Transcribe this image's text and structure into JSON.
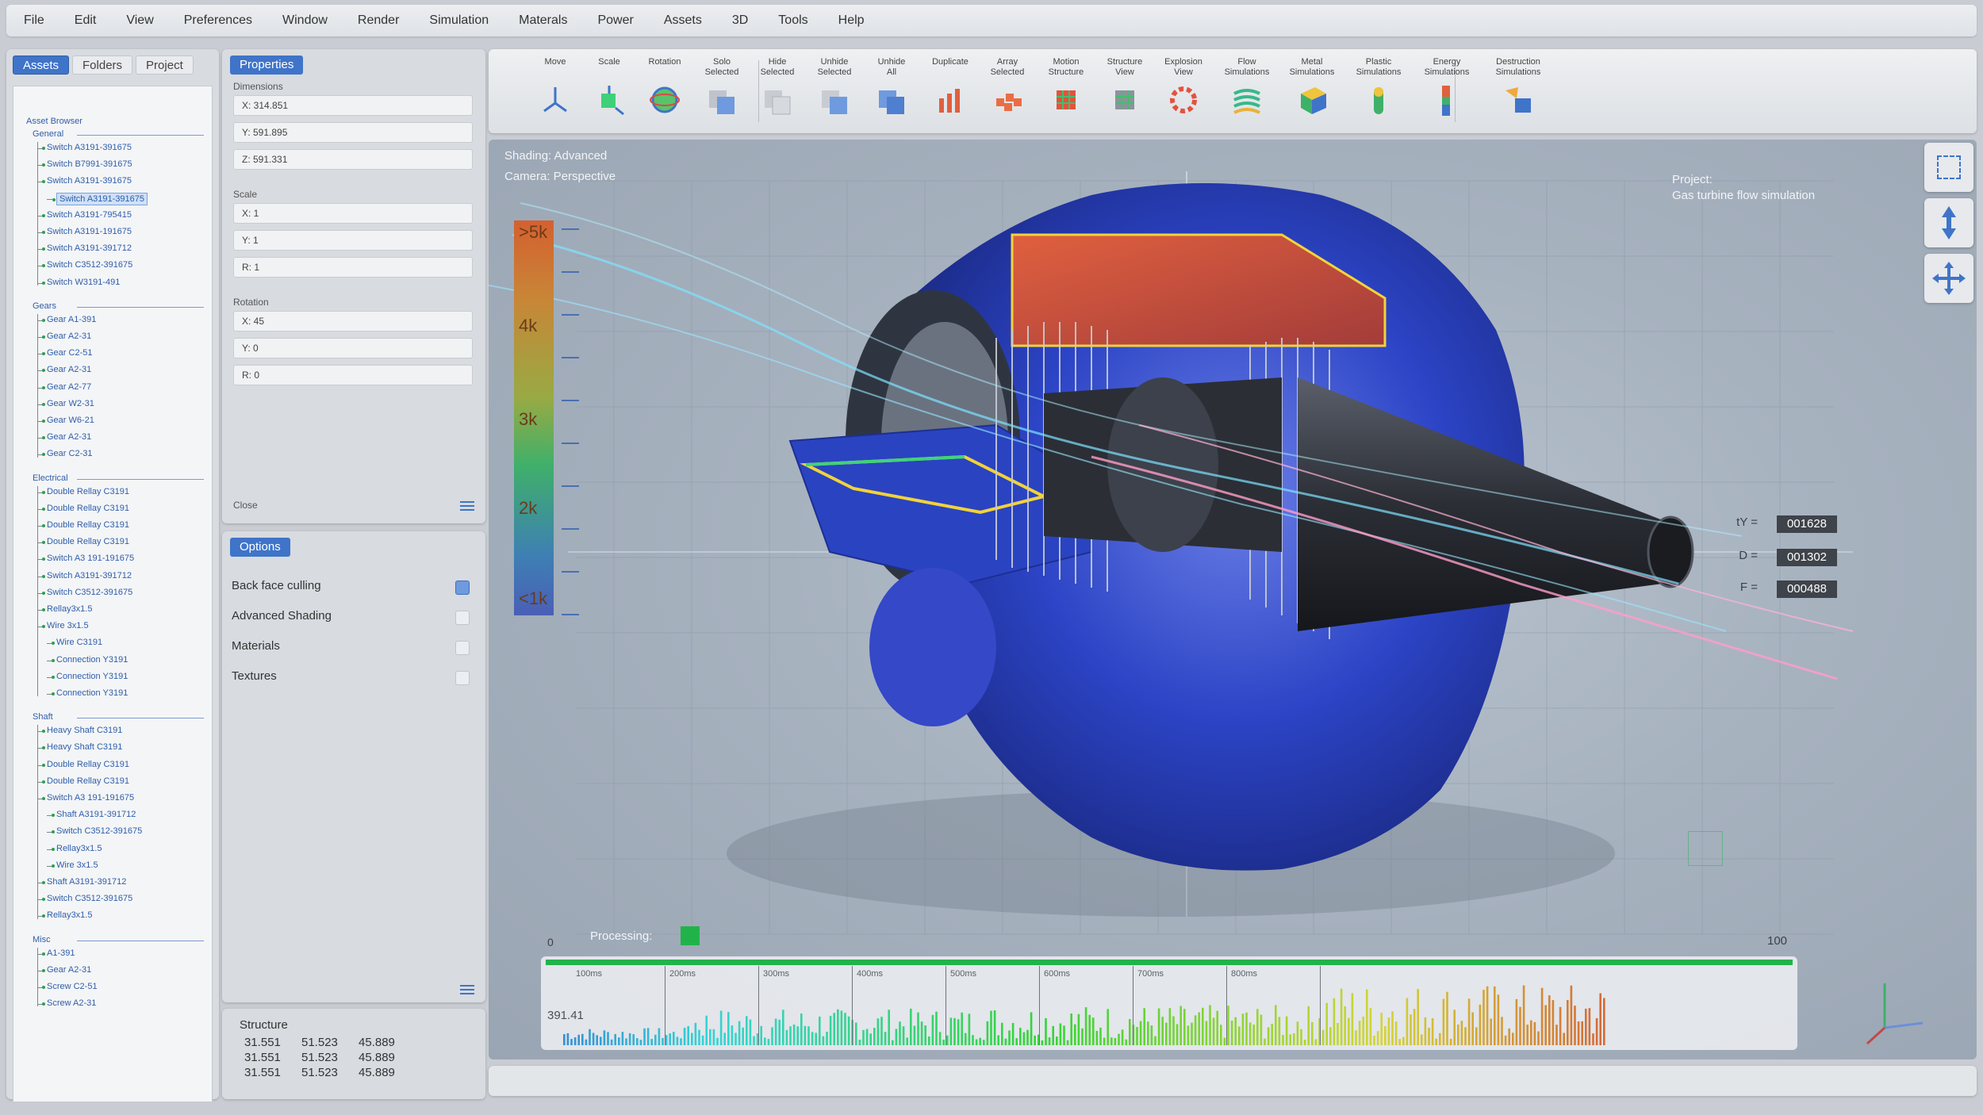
{
  "menu": [
    "File",
    "Edit",
    "View",
    "Preferences",
    "Window",
    "Render",
    "Simulation",
    "Materals",
    "Power",
    "Assets",
    "3D",
    "Tools",
    "Help"
  ],
  "assets_panel": {
    "tabs": [
      "Assets",
      "Folders",
      "Project"
    ],
    "active_tab": "Assets",
    "browser_title": "Asset Browser",
    "groups": [
      {
        "label": "General",
        "items": [
          {
            "label": "Switch A3191-391675",
            "level": 1
          },
          {
            "label": "Switch B7991-391675",
            "level": 1
          },
          {
            "label": "Switch A3191-391675",
            "level": 1
          },
          {
            "label": "Switch A3191-391675",
            "level": 2,
            "selected": true
          },
          {
            "label": "Switch A3191-795415",
            "level": 1
          },
          {
            "label": "Switch A3191-191675",
            "level": 1
          },
          {
            "label": "Switch A3191-391712",
            "level": 1
          },
          {
            "label": "Switch C3512-391675",
            "level": 1
          },
          {
            "label": "Switch W3191-491",
            "level": 1
          }
        ]
      },
      {
        "label": "Gears",
        "items": [
          {
            "label": "Gear A1-391",
            "level": 1
          },
          {
            "label": "Gear A2-31",
            "level": 1
          },
          {
            "label": "Gear C2-51",
            "level": 1
          },
          {
            "label": "Gear A2-31",
            "level": 1
          },
          {
            "label": "Gear A2-77",
            "level": 1
          },
          {
            "label": "Gear W2-31",
            "level": 1
          },
          {
            "label": "Gear W6-21",
            "level": 1
          },
          {
            "label": "Gear A2-31",
            "level": 1
          },
          {
            "label": "Gear C2-31",
            "level": 1
          }
        ]
      },
      {
        "label": "Electrical",
        "items": [
          {
            "label": "Double Rellay C3191",
            "level": 1
          },
          {
            "label": "Double Rellay C3191",
            "level": 1
          },
          {
            "label": "Double Rellay C3191",
            "level": 1
          },
          {
            "label": "Double Rellay C3191",
            "level": 1
          },
          {
            "label": "Switch A3 191-191675",
            "level": 1
          },
          {
            "label": "Switch A3191-391712",
            "level": 1
          },
          {
            "label": "Switch C3512-391675",
            "level": 1
          },
          {
            "label": "Rellay3x1.5",
            "level": 1
          },
          {
            "label": "Wire 3x1.5",
            "level": 1
          },
          {
            "label": "Wire C3191",
            "level": 2
          },
          {
            "label": "Connection Y3191",
            "level": 2
          },
          {
            "label": "Connection Y3191",
            "level": 2
          },
          {
            "label": "Connection Y3191",
            "level": 2
          }
        ]
      },
      {
        "label": "Shaft",
        "items": [
          {
            "label": "Heavy Shaft C3191",
            "level": 1
          },
          {
            "label": "Heavy Shaft C3191",
            "level": 1
          },
          {
            "label": "Double Rellay C3191",
            "level": 1
          },
          {
            "label": "Double Rellay C3191",
            "level": 1
          },
          {
            "label": "Switch A3 191-191675",
            "level": 1
          },
          {
            "label": "Shaft A3191-391712",
            "level": 2
          },
          {
            "label": "Switch C3512-391675",
            "level": 2
          },
          {
            "label": "Rellay3x1.5",
            "level": 2
          },
          {
            "label": "Wire 3x1.5",
            "level": 2
          },
          {
            "label": "Shaft A3191-391712",
            "level": 1
          },
          {
            "label": "Switch C3512-391675",
            "level": 1
          },
          {
            "label": "Rellay3x1.5",
            "level": 1
          }
        ]
      },
      {
        "label": "Misc",
        "items": [
          {
            "label": "A1-391",
            "level": 1
          },
          {
            "label": "Gear A2-31",
            "level": 1
          },
          {
            "label": "Screw C2-51",
            "level": 1
          },
          {
            "label": "Screw A2-31",
            "level": 1
          }
        ]
      }
    ]
  },
  "properties": {
    "title": "Properties",
    "dimensions_label": "Dimensions",
    "dimensions": [
      "X: 314.851",
      "Y: 591.895",
      "Z: 591.331"
    ],
    "scale_label": "Scale",
    "scale": [
      "X: 1",
      "Y: 1",
      "R: 1"
    ],
    "rotation_label": "Rotation",
    "rotation": [
      "X: 45",
      "Y: 0",
      "R: 0"
    ],
    "close_label": "Close"
  },
  "options": {
    "title": "Options",
    "items": [
      {
        "label": "Back face culling",
        "checked": true
      },
      {
        "label": "Advanced Shading",
        "checked": false
      },
      {
        "label": "Materials",
        "checked": false
      },
      {
        "label": "Textures",
        "checked": false
      }
    ]
  },
  "structure": {
    "title": "Structure",
    "rows": [
      [
        "31.551",
        "51.523",
        "45.889"
      ],
      [
        "31.551",
        "51.523",
        "45.889"
      ],
      [
        "31.551",
        "51.523",
        "45.889"
      ]
    ]
  },
  "toolbar": {
    "tools": [
      {
        "label": "Move",
        "icon": "move-axes-icon"
      },
      {
        "label": "Scale",
        "icon": "scale-cube-icon"
      },
      {
        "label": "Rotation",
        "icon": "rotation-sphere-icon"
      },
      {
        "label": "Solo\nSelected",
        "icon": "solo-selected-icon"
      },
      {
        "label": "Hide\nSelected",
        "icon": "hide-selected-icon"
      },
      {
        "label": "Unhide\nSelected",
        "icon": "unhide-selected-icon"
      },
      {
        "label": "Unhide\nAll",
        "icon": "unhide-all-icon"
      },
      {
        "label": "Duplicate",
        "icon": "duplicate-icon"
      },
      {
        "label": "Array\nSelected",
        "icon": "array-selected-icon"
      },
      {
        "label": "Motion\nStructure",
        "icon": "motion-structure-icon"
      },
      {
        "label": "Structure\nView",
        "icon": "structure-view-icon"
      },
      {
        "label": "Explosion\nView",
        "icon": "explosion-view-icon"
      },
      {
        "label": "Flow\nSimulations",
        "icon": "flow-simulation-icon"
      },
      {
        "label": "Metal\nSimulations",
        "icon": "metal-simulation-icon"
      },
      {
        "label": "Plastic\nSimulations",
        "icon": "plastic-simulation-icon"
      },
      {
        "label": "Energy\nSimulations",
        "icon": "energy-simulation-icon"
      },
      {
        "label": "Destruction\nSimulations",
        "icon": "destruction-simulation-icon"
      }
    ]
  },
  "viewport": {
    "shading": "Shading: Advanced",
    "camera": "Camera: Perspective",
    "project_label": "Project:",
    "project_name": "Gas turbine flow simulation",
    "legend": [
      ">5k",
      "4k",
      "3k",
      "2k",
      "<1k"
    ],
    "readouts": [
      {
        "label": "tY =",
        "value": "001628"
      },
      {
        "label": "D =",
        "value": "001302"
      },
      {
        "label": "F =",
        "value": "000488"
      }
    ],
    "processing_label": "Processing:",
    "progress_min": "0",
    "progress_max": "100",
    "timeline_ticks": [
      "100ms",
      "200ms",
      "300ms",
      "400ms",
      "500ms",
      "600ms",
      "700ms",
      "800ms"
    ],
    "timeline_value": "391.41"
  },
  "colors": {
    "accent": "#3f74c9",
    "processing": "#21b34a",
    "turbine_body": "#2f47c4"
  }
}
